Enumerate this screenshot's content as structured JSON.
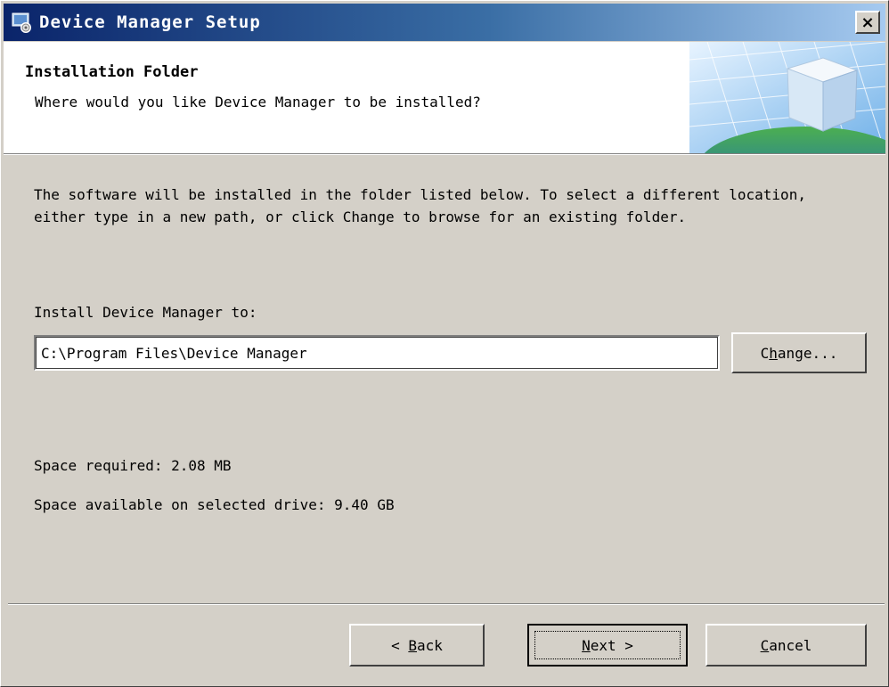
{
  "window": {
    "title": "Device Manager Setup",
    "close_label": "×"
  },
  "header": {
    "title": "Installation Folder",
    "subtitle": "Where would you like Device Manager to be installed?"
  },
  "content": {
    "description": "The software will be installed in the folder listed below. To select a different location, either type in a new path, or click Change to browse for an existing folder.",
    "install_label": "Install Device Manager to:",
    "install_path": "C:\\Program Files\\Device Manager",
    "space_required": "Space required: 2.08 MB",
    "space_available": "Space available on selected drive: 9.40 GB"
  },
  "buttons": {
    "change": {
      "label": "Change...",
      "mnemonic": "h"
    },
    "back": {
      "label": "< Back",
      "mnemonic": "B"
    },
    "next": {
      "label": "Next >",
      "mnemonic": "N"
    },
    "cancel": {
      "label": "Cancel",
      "mnemonic": "C"
    }
  },
  "icons": {
    "app_icon": "setup-app-icon",
    "header_graphic": "globe-cube-icon"
  },
  "colors": {
    "titlebar_start": "#0a246a",
    "titlebar_end": "#a6caf0",
    "dialog_bg": "#d4d0c8",
    "header_bg": "#ffffff"
  }
}
